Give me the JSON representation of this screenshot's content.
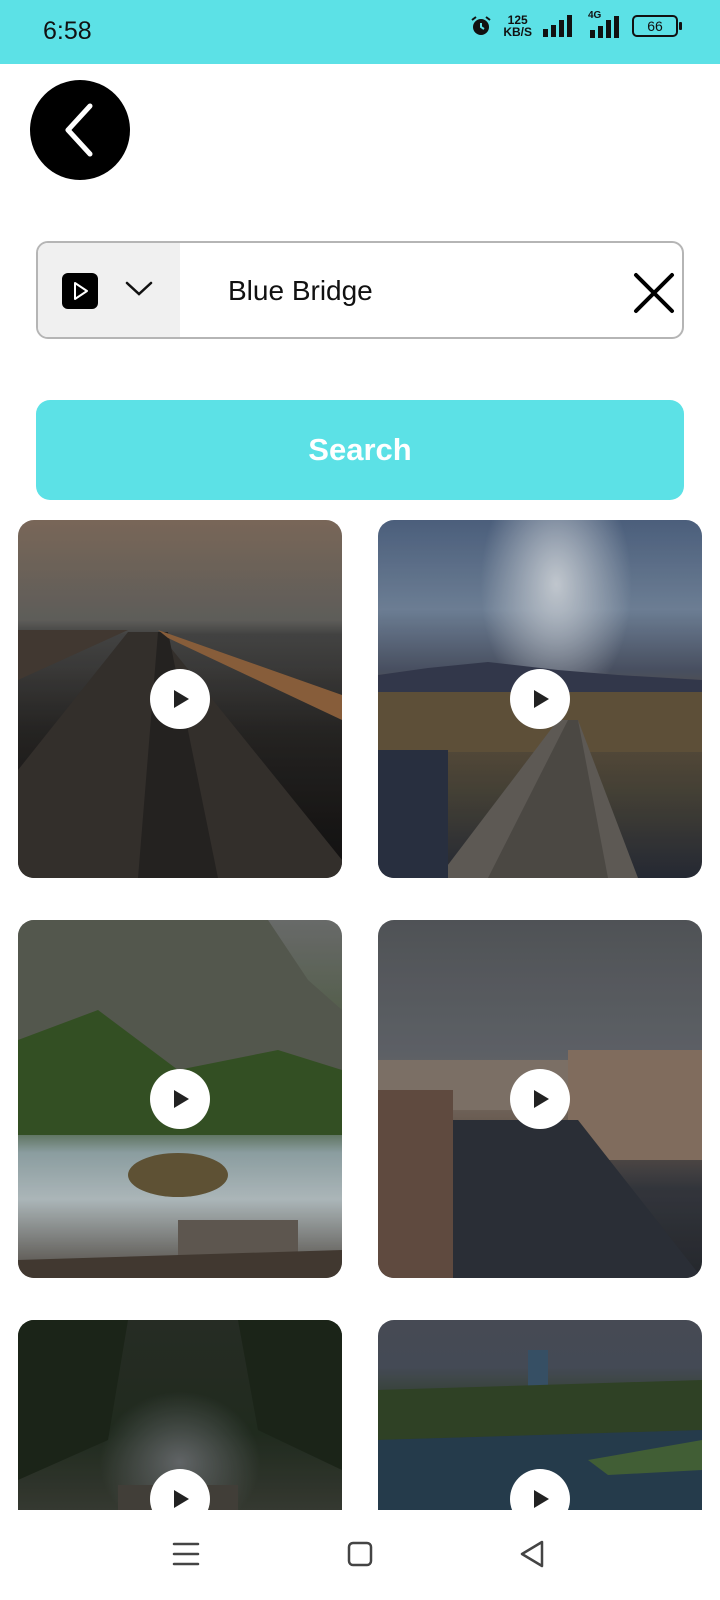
{
  "status_bar": {
    "time": "6:58",
    "speed_value": "125",
    "speed_unit": "KB/S",
    "network": "4G",
    "battery": "66"
  },
  "search": {
    "query": "Blue Bridge",
    "button_label": "Search"
  },
  "colors": {
    "accent": "#5ce1e6",
    "back_button": "#000000"
  },
  "results": [
    {
      "icon": "play-icon"
    },
    {
      "icon": "play-icon"
    },
    {
      "icon": "play-icon"
    },
    {
      "icon": "play-icon"
    },
    {
      "icon": "play-icon"
    },
    {
      "icon": "play-icon"
    }
  ],
  "icons": {
    "back": "chevron-left-icon",
    "media_type": "video-icon",
    "dropdown": "chevron-down-icon",
    "clear": "close-icon",
    "nav_menu": "menu-icon",
    "nav_home": "home-icon",
    "nav_back": "back-triangle-icon"
  }
}
